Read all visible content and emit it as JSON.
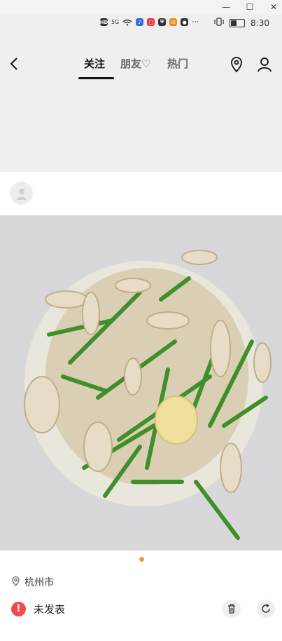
{
  "window": {
    "minimize_symbol": "—",
    "maximize_symbol": "☐",
    "close_symbol": "✕"
  },
  "status": {
    "time": "8:30",
    "network": "HD",
    "signal": "5G",
    "icons": [
      "wifi-icon",
      "music-icon",
      "red-app-icon",
      "shield-icon",
      "orange-app-icon",
      "record-icon",
      "more-icon"
    ]
  },
  "nav": {
    "tabs": [
      {
        "label": "关注",
        "active": true
      },
      {
        "label": "朋友♡",
        "active": false
      },
      {
        "label": "热门",
        "active": false
      }
    ]
  },
  "post": {
    "location": "杭州市",
    "status_text": "未发表",
    "error_symbol": "!"
  },
  "colors": {
    "header_bg": "#efefef",
    "accent": "#f39c32",
    "error": "#f04a4a"
  }
}
